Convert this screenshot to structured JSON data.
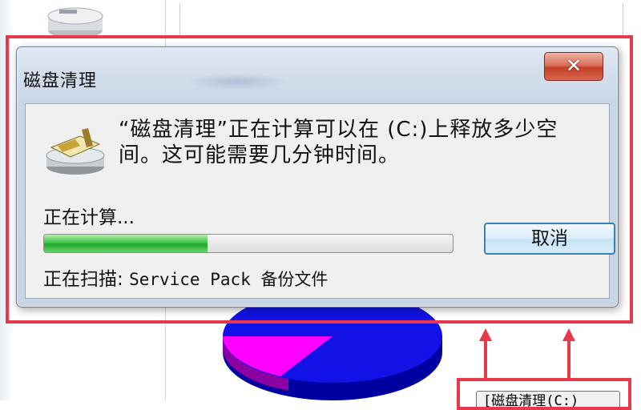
{
  "background": {
    "bottom_button_text": "[磁盘清理(C:)"
  },
  "dialog": {
    "title": "磁盘清理",
    "close_label": "✕",
    "message": "“磁盘清理”正在计算可以在 (C:)上释放多少空间。这可能需要几分钟时间。",
    "status": "正在计算...",
    "progress_fraction": 0.4,
    "cancel_label": "取消",
    "scan_label": "正在扫描: ",
    "scan_target": "Service Pack 备份文件"
  },
  "colors": {
    "highlight_red": "#e8384b",
    "progress_green": "#2bb13a",
    "pie_blue": "#1010e0",
    "pie_magenta": "#ff00ff"
  },
  "icons": [
    "drive-icon",
    "disk-cleanup-icon",
    "close-icon",
    "up-arrow-icon"
  ]
}
